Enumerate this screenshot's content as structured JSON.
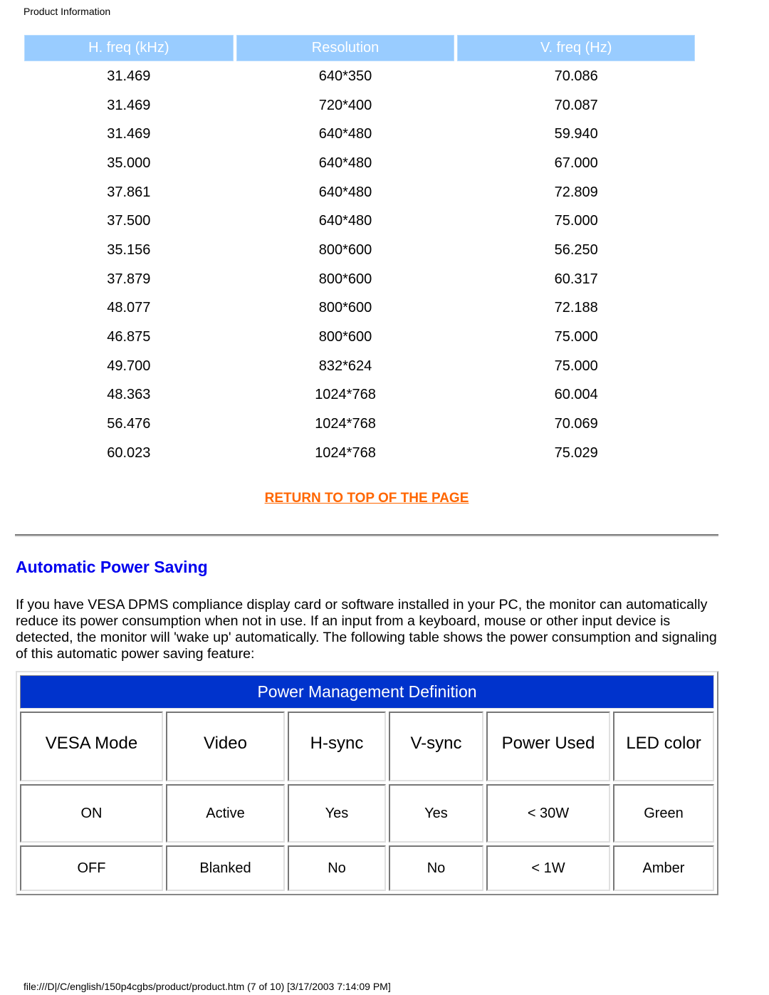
{
  "page": {
    "header_title": "Product Information",
    "footer_text": "file:///D|/C/english/150p4cgbs/product/product.htm (7 of 10) [3/17/2003 7:14:09 PM]"
  },
  "freq_table": {
    "headers": [
      "H. freq (kHz)",
      "Resolution",
      "V. freq (Hz)"
    ],
    "rows": [
      [
        "31.469",
        "640*350",
        "70.086"
      ],
      [
        "31.469",
        "720*400",
        "70.087"
      ],
      [
        "31.469",
        "640*480",
        "59.940"
      ],
      [
        "35.000",
        "640*480",
        "67.000"
      ],
      [
        "37.861",
        "640*480",
        "72.809"
      ],
      [
        "37.500",
        "640*480",
        "75.000"
      ],
      [
        "35.156",
        "800*600",
        "56.250"
      ],
      [
        "37.879",
        "800*600",
        "60.317"
      ],
      [
        "48.077",
        "800*600",
        "72.188"
      ],
      [
        "46.875",
        "800*600",
        "75.000"
      ],
      [
        "49.700",
        "832*624",
        "75.000"
      ],
      [
        "48.363",
        "1024*768",
        "60.004"
      ],
      [
        "56.476",
        "1024*768",
        "70.069"
      ],
      [
        "60.023",
        "1024*768",
        "75.029"
      ]
    ]
  },
  "return_link": {
    "label": "RETURN TO TOP OF THE PAGE"
  },
  "power_section": {
    "title": "Automatic Power Saving",
    "intro": "If you have VESA DPMS compliance display card or software installed in your PC, the monitor can automatically reduce its power consumption when not in use. If an input from a keyboard, mouse or other input device is detected, the monitor will 'wake up' automatically. The following table shows the power consumption and signaling of this automatic power saving feature:",
    "table": {
      "title": "Power Management Definition",
      "headers": [
        "VESA Mode",
        "Video",
        "H-sync",
        "V-sync",
        "Power Used",
        "LED color"
      ],
      "rows": [
        [
          "ON",
          "Active",
          "Yes",
          "Yes",
          "< 30W",
          "Green"
        ],
        [
          "OFF",
          "Blanked",
          "No",
          "No",
          "< 1W",
          "Amber"
        ]
      ]
    }
  },
  "colors": {
    "freq_header_bg": "#99ccff",
    "power_title_bg": "#0033cc",
    "link_color": "#ff6600",
    "section_title_color": "#0000ee"
  }
}
